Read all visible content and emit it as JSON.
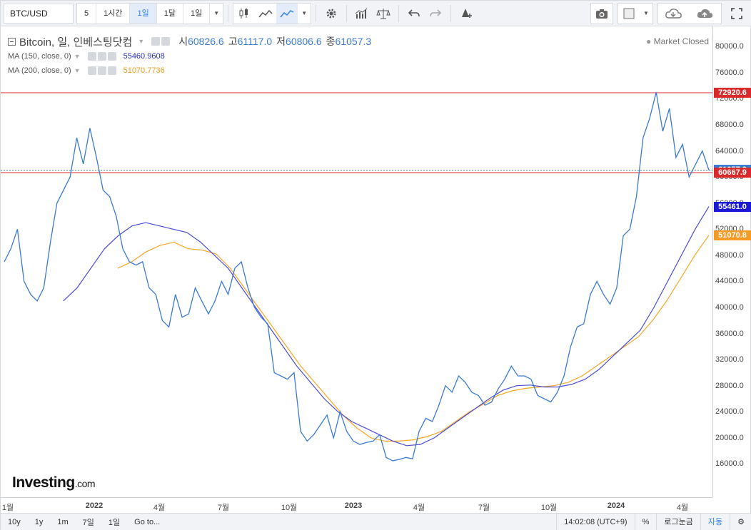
{
  "toolbar": {
    "symbol": "BTC/USD",
    "intervals": [
      "5",
      "1시간",
      "1일",
      "1달",
      "1일"
    ],
    "active_interval": 2,
    "icons": [
      "candles-icon",
      "area-icon",
      "line-icon",
      "settings-icon",
      "bars-icon",
      "scale-icon",
      "undo-icon",
      "redo-icon",
      "alert-icon",
      "camera-icon",
      "rect-icon",
      "cloud-download-icon",
      "cloud-upload-icon",
      "fullscreen-icon"
    ]
  },
  "legend": {
    "title": "Bitcoin, 일, 인베스팅닷컴",
    "open_label": "시",
    "open": "60826.6",
    "high_label": "고",
    "high": "61117.0",
    "low_label": "저",
    "low": "60806.6",
    "close_label": "종",
    "close": "61057.3",
    "ma150_name": "MA (150, close, 0)",
    "ma150_value": "55460.9608",
    "ma200_name": "MA (200, close, 0)",
    "ma200_value": "51070.7736"
  },
  "market_status": "Market Closed",
  "bottom": {
    "ranges": [
      "10y",
      "1y",
      "1m",
      "7일",
      "1일",
      "Go to..."
    ],
    "time": "14:02:08 (UTC+9)",
    "percent": "%",
    "log": "로그눈금",
    "auto": "자동"
  },
  "logo": {
    "main": "Investing",
    "suffix": ".com"
  },
  "colors": {
    "price": "#3b7ad1",
    "ma150": "#4b4bd6",
    "ma200": "#f5a623",
    "high_line": "#d9292b",
    "last": "#3b7ad1"
  },
  "chart_data": {
    "type": "line",
    "ylim": [
      12000,
      82000
    ],
    "y_ticks": [
      16000,
      20000,
      24000,
      28000,
      32000,
      36000,
      40000,
      44000,
      48000,
      52000,
      56000,
      60000,
      64000,
      68000,
      72000,
      76000,
      80000
    ],
    "x_ticks": [
      "1월",
      "2022",
      "4월",
      "7월",
      "10월",
      "2023",
      "4월",
      "7월",
      "10월",
      "2024",
      "4월"
    ],
    "tags": [
      {
        "label": "72920.6",
        "value": 72920.6,
        "color": "#d9292b"
      },
      {
        "label": "61057.3",
        "value": 61057.3,
        "color": "#3b7ad1"
      },
      {
        "label": "60667.9",
        "value": 60667.9,
        "color": "#d9292b"
      },
      {
        "label": "55461.0",
        "value": 55461.0,
        "color": "#1a1ad6"
      },
      {
        "label": "51070.8",
        "value": 51070.8,
        "color": "#f59a23"
      }
    ],
    "series": [
      {
        "name": "Bitcoin",
        "color": "#3b7ad1",
        "values": [
          47000,
          49000,
          52000,
          44000,
          42000,
          41000,
          43000,
          50000,
          56000,
          58000,
          60000,
          66000,
          62000,
          67500,
          63000,
          58000,
          57000,
          54000,
          49000,
          47000,
          46500,
          47000,
          43000,
          42000,
          38000,
          37000,
          42000,
          38500,
          39000,
          43000,
          41000,
          39000,
          41000,
          44000,
          42000,
          46000,
          47000,
          43000,
          40000,
          38500,
          37500,
          30000,
          29500,
          29000,
          30000,
          21000,
          19500,
          20500,
          22000,
          23500,
          20000,
          24000,
          21000,
          19500,
          19000,
          19300,
          19500,
          20500,
          17000,
          16500,
          16700,
          17000,
          16800,
          21000,
          23000,
          22500,
          25000,
          28000,
          27000,
          29500,
          28500,
          27000,
          26500,
          25000,
          25500,
          27500,
          29000,
          31000,
          29500,
          29500,
          29000,
          26500,
          26000,
          25500,
          27000,
          29500,
          34000,
          37000,
          37500,
          42000,
          44000,
          42000,
          40500,
          43000,
          51000,
          52000,
          57000,
          66000,
          69000,
          73000,
          67000,
          70500,
          63000,
          65000,
          60000,
          62000,
          64000,
          61057
        ]
      },
      {
        "name": "MA (150, close, 0)",
        "color": "#4b4bd6",
        "values": [
          null,
          null,
          null,
          41000,
          43000,
          46000,
          49000,
          51000,
          52500,
          53000,
          52500,
          52000,
          51500,
          50000,
          48000,
          46000,
          43000,
          40000,
          37000,
          34000,
          31000,
          28500,
          26000,
          24000,
          22500,
          21500,
          20500,
          19500,
          18800,
          19000,
          20000,
          21500,
          23000,
          24500,
          26000,
          27300,
          28000,
          28100,
          27800,
          27800,
          28200,
          29000,
          30500,
          32500,
          34500,
          36500,
          40000,
          44000,
          48000,
          52000,
          55461
        ]
      },
      {
        "name": "MA (200, close, 0)",
        "color": "#f5a623",
        "values": [
          null,
          null,
          null,
          null,
          46000,
          47000,
          48500,
          49500,
          50000,
          49000,
          48800,
          48200,
          46000,
          43000,
          40000,
          37000,
          34000,
          31000,
          28500,
          26000,
          23500,
          21500,
          20000,
          19500,
          19500,
          19700,
          20200,
          21000,
          22500,
          24000,
          25200,
          26500,
          27200,
          27600,
          27800,
          28000,
          28500,
          29500,
          31000,
          32500,
          34000,
          35500,
          38000,
          41000,
          44500,
          48000,
          51071
        ]
      }
    ]
  }
}
